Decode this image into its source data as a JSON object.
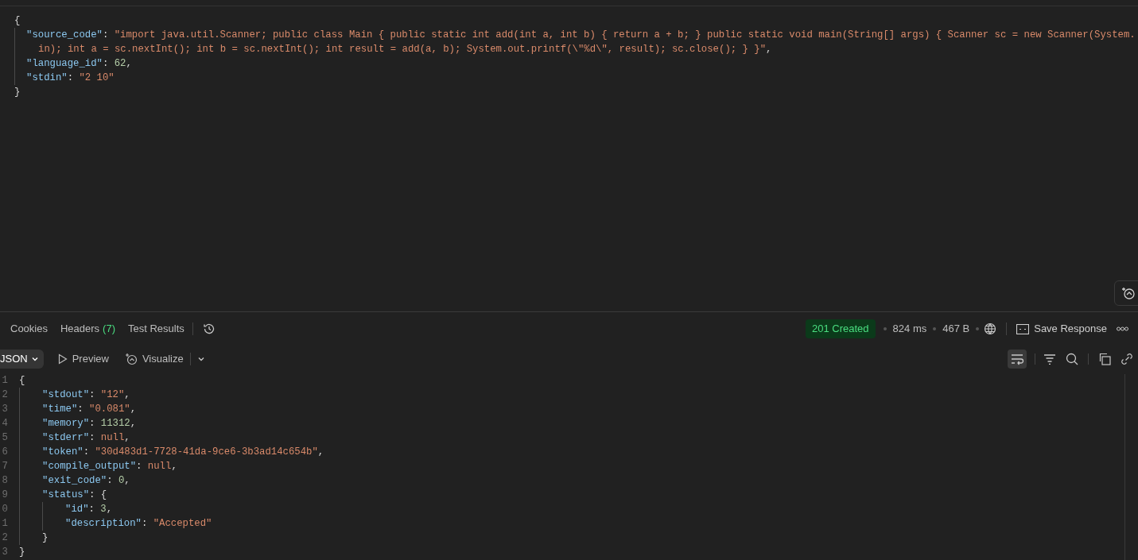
{
  "request_body": {
    "lines": [
      {
        "tokens": [
          {
            "kind": "punct",
            "text": "{"
          }
        ],
        "children": [
          {
            "tokens": [
              {
                "kind": "key",
                "text": "\"source_code\""
              },
              {
                "kind": "punct",
                "text": ": "
              },
              {
                "kind": "string",
                "text": "\"import java.util.Scanner; public class Main { public static int add(int a, int b) { return a + b; } public static void main(String[] args) { Scanner sc = new Scanner(System."
              }
            ]
          },
          {
            "continuation": true,
            "tokens": [
              {
                "kind": "string",
                "text": "in); int a = sc.nextInt(); int b = sc.nextInt(); int result = add(a, b); System.out.printf(\\\"%d\\\", result); sc.close(); } }\""
              },
              {
                "kind": "punct",
                "text": ","
              }
            ]
          },
          {
            "tokens": [
              {
                "kind": "key",
                "text": "\"language_id\""
              },
              {
                "kind": "punct",
                "text": ": "
              },
              {
                "kind": "number",
                "text": "62"
              },
              {
                "kind": "punct",
                "text": ","
              }
            ]
          },
          {
            "tokens": [
              {
                "kind": "key",
                "text": "\"stdin\""
              },
              {
                "kind": "punct",
                "text": ": "
              },
              {
                "kind": "string",
                "text": "\"2 10\""
              }
            ]
          }
        ]
      },
      {
        "tokens": [
          {
            "kind": "punct",
            "text": "}"
          }
        ]
      }
    ]
  },
  "response_tabs": [
    {
      "label": "Cookies",
      "selected": false
    },
    {
      "label": "Headers",
      "count": "(7)",
      "selected": false
    },
    {
      "label": "Test Results",
      "selected": false
    }
  ],
  "status": {
    "code": "201 Created",
    "time": "824 ms",
    "size": "467 B",
    "save_label": "Save Response"
  },
  "toolbar": {
    "format": "JSON",
    "preview": "Preview",
    "visualize": "Visualize",
    "wrap_selected": true
  },
  "response_body": {
    "lines": [
      {
        "number": "1",
        "tokens": [
          {
            "kind": "punct",
            "text": "{"
          }
        ],
        "children": [
          {
            "number": "2",
            "tokens": [
              {
                "kind": "key",
                "text": "\"stdout\""
              },
              {
                "kind": "punct",
                "text": ": "
              },
              {
                "kind": "string",
                "text": "\"12\""
              },
              {
                "kind": "punct",
                "text": ","
              }
            ]
          },
          {
            "number": "3",
            "tokens": [
              {
                "kind": "key",
                "text": "\"time\""
              },
              {
                "kind": "punct",
                "text": ": "
              },
              {
                "kind": "string",
                "text": "\"0.081\""
              },
              {
                "kind": "punct",
                "text": ","
              }
            ]
          },
          {
            "number": "4",
            "tokens": [
              {
                "kind": "key",
                "text": "\"memory\""
              },
              {
                "kind": "punct",
                "text": ": "
              },
              {
                "kind": "number",
                "text": "11312"
              },
              {
                "kind": "punct",
                "text": ","
              }
            ]
          },
          {
            "number": "5",
            "tokens": [
              {
                "kind": "key",
                "text": "\"stderr\""
              },
              {
                "kind": "punct",
                "text": ": "
              },
              {
                "kind": "null",
                "text": "null"
              },
              {
                "kind": "punct",
                "text": ","
              }
            ]
          },
          {
            "number": "6",
            "tokens": [
              {
                "kind": "key",
                "text": "\"token\""
              },
              {
                "kind": "punct",
                "text": ": "
              },
              {
                "kind": "string",
                "text": "\"30d483d1-7728-41da-9ce6-3b3ad14c654b\""
              },
              {
                "kind": "punct",
                "text": ","
              }
            ]
          },
          {
            "number": "7",
            "tokens": [
              {
                "kind": "key",
                "text": "\"compile_output\""
              },
              {
                "kind": "punct",
                "text": ": "
              },
              {
                "kind": "null",
                "text": "null"
              },
              {
                "kind": "punct",
                "text": ","
              }
            ]
          },
          {
            "number": "8",
            "tokens": [
              {
                "kind": "key",
                "text": "\"exit_code\""
              },
              {
                "kind": "punct",
                "text": ": "
              },
              {
                "kind": "number",
                "text": "0"
              },
              {
                "kind": "punct",
                "text": ","
              }
            ]
          },
          {
            "number": "9",
            "tokens": [
              {
                "kind": "key",
                "text": "\"status\""
              },
              {
                "kind": "punct",
                "text": ": {"
              }
            ],
            "children": [
              {
                "number": "0",
                "tokens": [
                  {
                    "kind": "key",
                    "text": "\"id\""
                  },
                  {
                    "kind": "punct",
                    "text": ": "
                  },
                  {
                    "kind": "number",
                    "text": "3"
                  },
                  {
                    "kind": "punct",
                    "text": ","
                  }
                ]
              },
              {
                "number": "1",
                "tokens": [
                  {
                    "kind": "key",
                    "text": "\"description\""
                  },
                  {
                    "kind": "punct",
                    "text": ": "
                  },
                  {
                    "kind": "string",
                    "text": "\"Accepted\""
                  }
                ]
              }
            ]
          },
          {
            "number": "2",
            "tokens": [
              {
                "kind": "punct",
                "text": "}"
              }
            ]
          }
        ]
      },
      {
        "number": "3",
        "tokens": [
          {
            "kind": "punct",
            "text": "}"
          }
        ]
      }
    ]
  }
}
